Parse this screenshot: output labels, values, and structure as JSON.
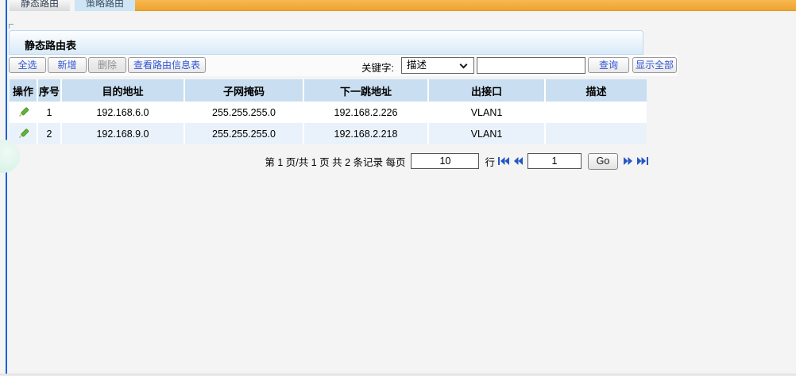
{
  "tabs": [
    {
      "label": "静态路由",
      "active": true
    },
    {
      "label": "策略路由",
      "active": false
    }
  ],
  "panel": {
    "title": "静态路由表"
  },
  "toolbar": {
    "select_all": "全选",
    "add": "新增",
    "delete": "删除",
    "view_route_table": "查看路由信息表",
    "keyword_label": "关键字:",
    "keyword_field": "描述",
    "search_value": "",
    "search": "查询",
    "show_all": "显示全部"
  },
  "table": {
    "headers": [
      "操作",
      "序号",
      "目的地址",
      "子网掩码",
      "下一跳地址",
      "出接口",
      "描述"
    ],
    "rows": [
      [
        "1",
        "192.168.6.0",
        "255.255.255.0",
        "192.168.2.226",
        "VLAN1",
        ""
      ],
      [
        "2",
        "192.168.9.0",
        "255.255.255.0",
        "192.168.2.218",
        "VLAN1",
        ""
      ]
    ]
  },
  "pagination": {
    "summary": "第 1 页/共 1 页 共 2 条记录 每页",
    "per_page": "10",
    "rows_unit": "行",
    "page": "1",
    "go": "Go"
  },
  "colors": {
    "accent_orange": "#f2a93b",
    "link_blue": "#2f55d4",
    "table_header_blue": "#c9def0",
    "row_alt_blue": "#e9f2fb",
    "nav_icon_blue": "#2456c4",
    "edit_pencil_green": "#5cb52f",
    "left_rule_blue": "#1565d8"
  }
}
